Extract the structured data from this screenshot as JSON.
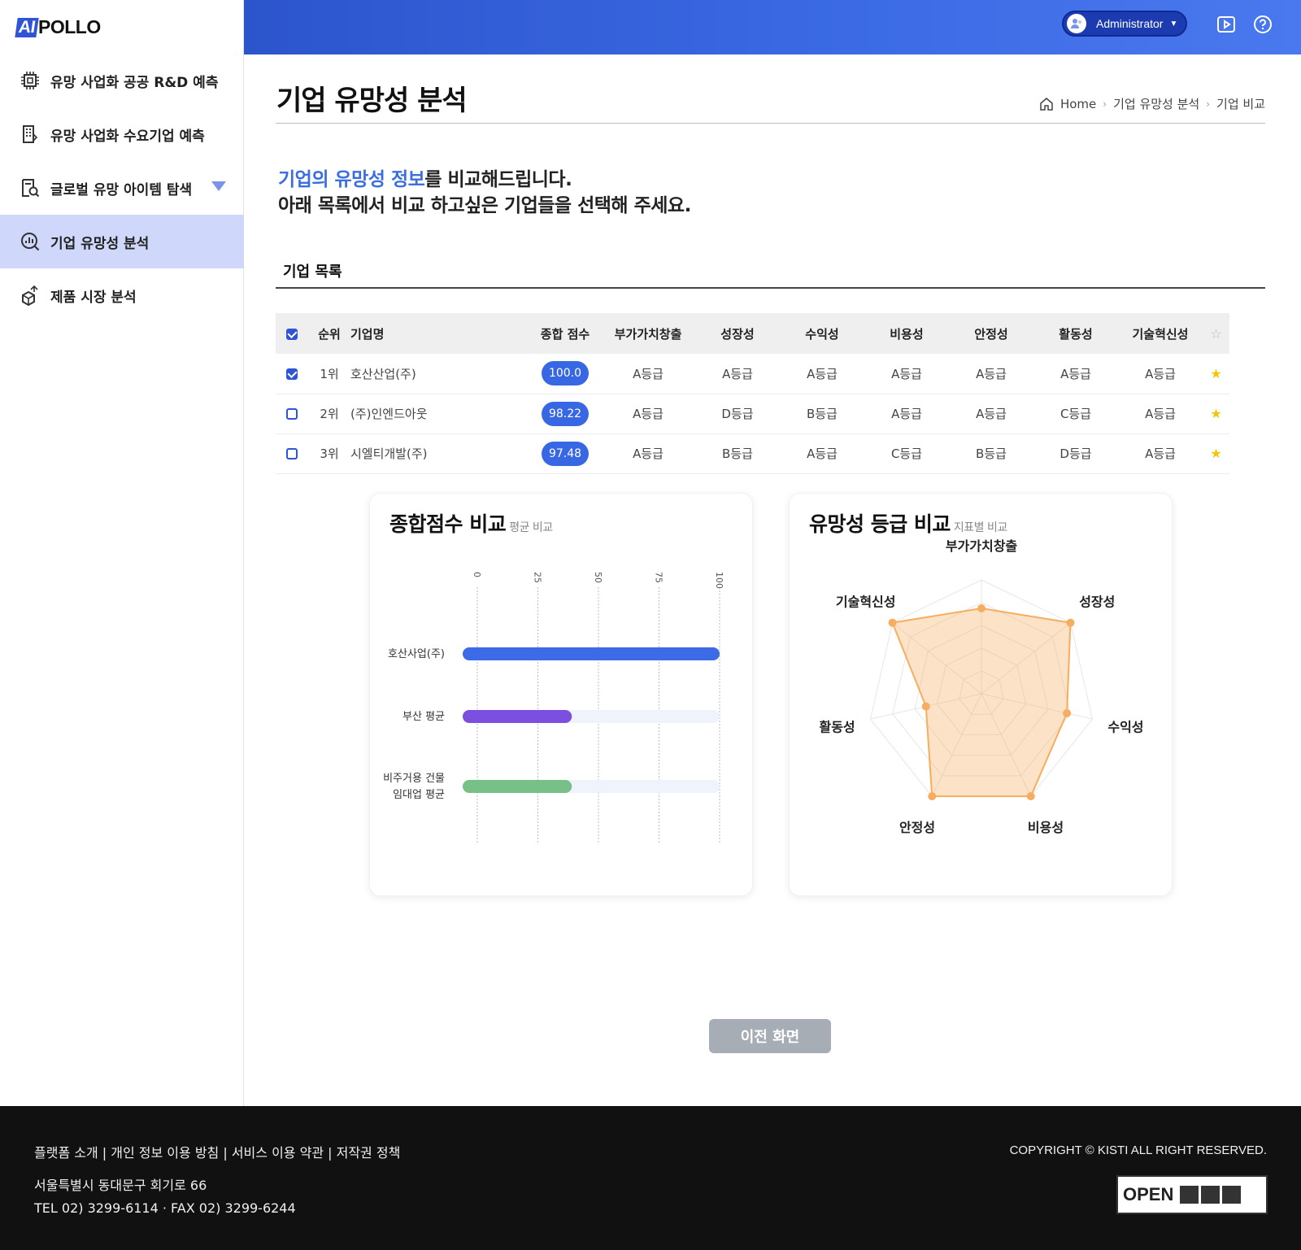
{
  "logo": {
    "mark": "AI",
    "rest": "POLLO"
  },
  "sidebar": {
    "items": [
      {
        "label": "유망 사업화 공공 R&D 예측",
        "icon": "chip-icon",
        "active": false
      },
      {
        "label": "유망 사업화 수요기업 예측",
        "icon": "building-icon",
        "active": false
      },
      {
        "label": "글로벌 유망 아이템 탐색",
        "icon": "doc-search-icon",
        "active": false
      },
      {
        "label": "기업 유망성 분석",
        "icon": "chart-search-icon",
        "active": true
      },
      {
        "label": "제품 시장 분석",
        "icon": "box-growth-icon",
        "active": false
      }
    ]
  },
  "header": {
    "user": "Administrator"
  },
  "page": {
    "title": "기업 유망성 분석",
    "breadcrumb": [
      "Home",
      "기업 유망성 분석",
      "기업 비교"
    ],
    "intro_highlight": "기업의 유망성 정보",
    "intro_rest1": "를 비교해드립니다.",
    "intro_line2": "아래 목록에서 비교 하고싶은 기업들을 선택해 주세요.",
    "list_title": "기업 목록"
  },
  "table": {
    "headers": [
      "순위",
      "기업명",
      "종합 점수",
      "부가가치창출",
      "성장성",
      "수익성",
      "비용성",
      "안정성",
      "활동성",
      "기술혁신성"
    ],
    "rows": [
      {
        "checked": true,
        "rank": "1위",
        "name": "호산산업(주)",
        "score": "100.0",
        "grades": [
          "A등급",
          "A등급",
          "A등급",
          "A등급",
          "A등급",
          "A등급",
          "A등급"
        ]
      },
      {
        "checked": false,
        "rank": "2위",
        "name": "(주)인엔드아웃",
        "score": "98.22",
        "grades": [
          "A등급",
          "D등급",
          "B등급",
          "A등급",
          "A등급",
          "C등급",
          "A등급"
        ]
      },
      {
        "checked": false,
        "rank": "3위",
        "name": "시엘티개발(주)",
        "score": "97.48",
        "grades": [
          "A등급",
          "B등급",
          "A등급",
          "C등급",
          "B등급",
          "D등급",
          "A등급"
        ]
      }
    ]
  },
  "chart_data": [
    {
      "type": "bar",
      "title": "종합점수 비교",
      "subtitle": "평균 비교",
      "categories": [
        "호산사업(주)",
        "부산 평균",
        "비주거용 건물 임대업 평균"
      ],
      "category_lines": [
        [
          "호산사업(주)"
        ],
        [
          "부산 평균"
        ],
        [
          "비주거용 건물",
          "임대업 평균"
        ]
      ],
      "values": [
        100,
        39,
        39
      ],
      "colors": [
        "#3d6ae6",
        "#7b4fe0",
        "#77c189"
      ],
      "xticks": [
        "0",
        "25",
        "50",
        "75",
        "100"
      ],
      "xlim": [
        0,
        100
      ],
      "orientation": "horizontal",
      "grid": true
    },
    {
      "type": "radar",
      "title": "유망성 등급 비교",
      "subtitle": "지표별 비교",
      "axes": [
        "부가가치창출",
        "성장성",
        "수익성",
        "비용성",
        "안정성",
        "활동성",
        "기술혁신성"
      ],
      "series": [
        {
          "values": [
            0.75,
            1.0,
            0.77,
            1.0,
            1.0,
            0.5,
            1.0
          ]
        }
      ],
      "rmax": 1,
      "color": "#f6ad5f"
    }
  ],
  "footer": {
    "links": "플랫폼 소개  |  개인 정보 이용 방침  |  서비스 이용 약관  |  저작권 정책",
    "address": "서울특별시 동대문구 회기로 66",
    "contact": "TEL 02) 3299-6114 · FAX 02) 3299-6244",
    "copyright": "COPYRIGHT © KISTI ALL RIGHT RESERVED.",
    "badge": "OPEN"
  },
  "buttons": {
    "prev": "이전 화면"
  }
}
